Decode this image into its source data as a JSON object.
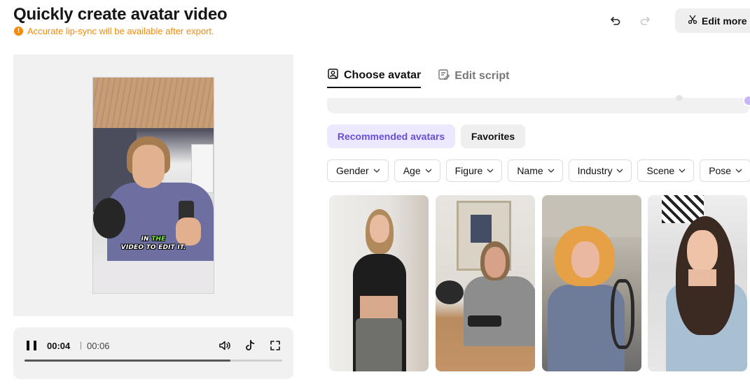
{
  "header": {
    "title": "Quickly create avatar video",
    "notice_icon": "!",
    "notice": "Accurate lip-sync will be available after export.",
    "undo_icon": "undo-icon",
    "redo_icon": "redo-icon",
    "edit_more_label": "Edit more",
    "edit_more_icon": "scissors-icon"
  },
  "preview": {
    "caption_line1_pre": "IN ",
    "caption_line1_highlight": "THE",
    "caption_line2": "VIDEO TO EDIT IT."
  },
  "player": {
    "current_time": "00:04",
    "separator": "|",
    "total_time": "00:06",
    "progress": 0.8,
    "icons": [
      "pause-icon",
      "volume-icon",
      "tiktok-icon",
      "fullscreen-icon"
    ]
  },
  "tabs": [
    {
      "label": "Choose avatar",
      "icon": "avatar-icon",
      "active": true
    },
    {
      "label": "Edit script",
      "icon": "script-icon",
      "active": false
    }
  ],
  "segments": {
    "recommended_label": "Recommended avatars",
    "favorites_label": "Favorites"
  },
  "filters": [
    {
      "label": "Gender"
    },
    {
      "label": "Age"
    },
    {
      "label": "Figure"
    },
    {
      "label": "Name"
    },
    {
      "label": "Industry"
    },
    {
      "label": "Scene"
    },
    {
      "label": "Pose"
    }
  ],
  "colors": {
    "accent": "#6a4ed6",
    "accent_bg": "#ece8fd",
    "warning": "#f38a08"
  }
}
